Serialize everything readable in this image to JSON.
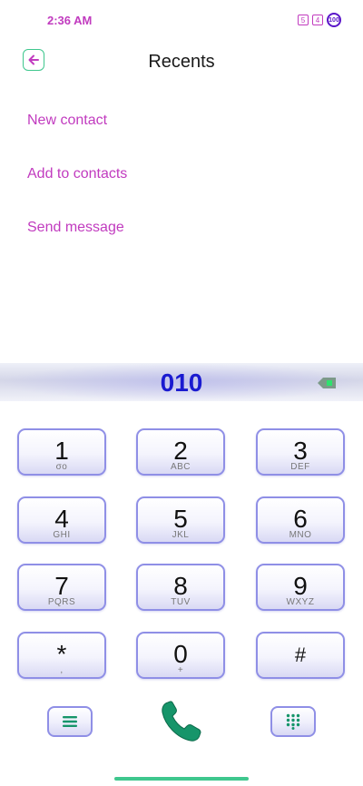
{
  "status_bar": {
    "time": "2:36 AM",
    "indicators": [
      "5",
      "4"
    ],
    "battery": "100"
  },
  "header": {
    "title": "Recents"
  },
  "menu": [
    {
      "label": "New contact"
    },
    {
      "label": "Add to contacts"
    },
    {
      "label": "Send message"
    }
  ],
  "dialer": {
    "number": "010",
    "keys": [
      {
        "digit": "1",
        "letters": "σο"
      },
      {
        "digit": "2",
        "letters": "ABC"
      },
      {
        "digit": "3",
        "letters": "DEF"
      },
      {
        "digit": "4",
        "letters": "GHI"
      },
      {
        "digit": "5",
        "letters": "JKL"
      },
      {
        "digit": "6",
        "letters": "MNO"
      },
      {
        "digit": "7",
        "letters": "PQRS"
      },
      {
        "digit": "8",
        "letters": "TUV"
      },
      {
        "digit": "9",
        "letters": "WXYZ"
      },
      {
        "digit": "*",
        "letters": ","
      },
      {
        "digit": "0",
        "letters": "+"
      },
      {
        "digit": "#",
        "letters": ""
      }
    ]
  },
  "icons": {
    "back": "arrow-left-icon",
    "backspace": "backspace-icon",
    "menu": "menu-icon",
    "call": "phone-icon",
    "keypad": "dialpad-icon"
  },
  "colors": {
    "accent": "#c13bbf",
    "number": "#1a1ad0",
    "call": "#16956a",
    "key_border": "#8f8fe6",
    "navbar": "#3fc78e"
  }
}
